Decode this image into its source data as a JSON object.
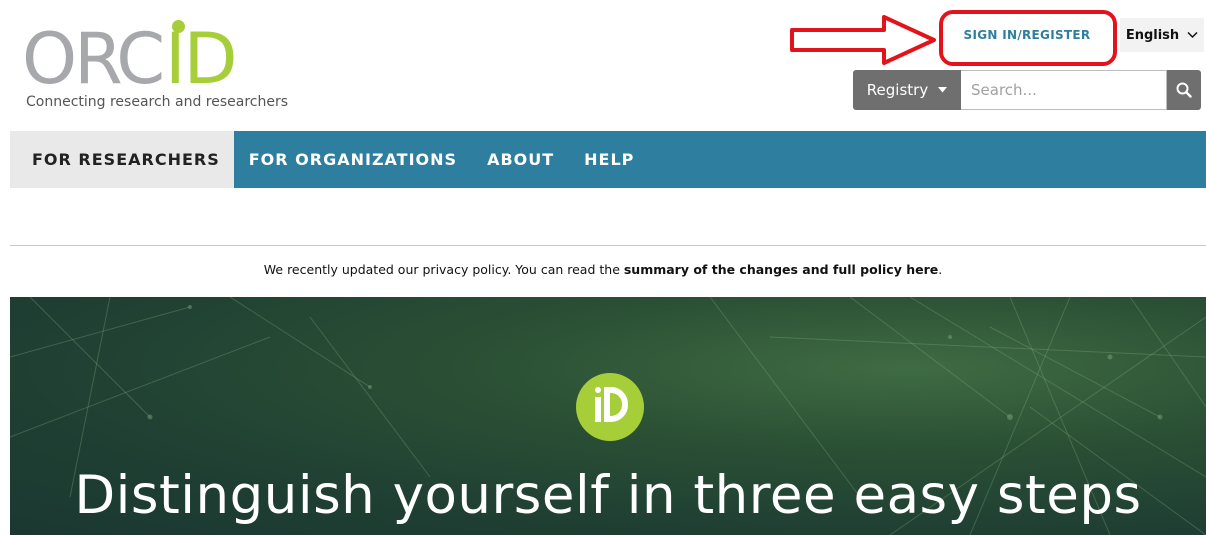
{
  "logo": {
    "orc": "ORC",
    "id": "ID",
    "tagline": "Connecting research and researchers"
  },
  "header": {
    "signin_label": "SIGN IN/REGISTER",
    "language_label": "English",
    "registry_label": "Registry",
    "search_placeholder": "Search..."
  },
  "nav": {
    "items": [
      {
        "label": "FOR RESEARCHERS"
      },
      {
        "label": "FOR ORGANIZATIONS"
      },
      {
        "label": "ABOUT"
      },
      {
        "label": "HELP"
      }
    ]
  },
  "notice": {
    "text": "We recently updated our privacy policy. You can read the ",
    "link": "summary of the changes and full policy here",
    "end": "."
  },
  "hero": {
    "title": "Distinguish yourself in three easy steps"
  },
  "colors": {
    "brand_green": "#a6ce39",
    "nav_teal": "#2e7f9f",
    "annotation_red": "#e3131b"
  }
}
